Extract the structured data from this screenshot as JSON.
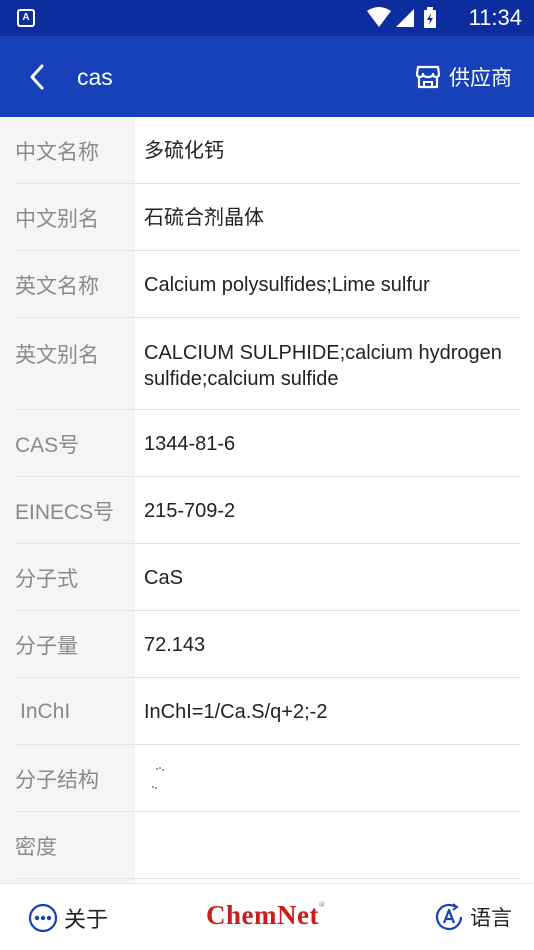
{
  "status_bar": {
    "notification_badge": "A",
    "time": "11:34",
    "icons": [
      "wifi-icon",
      "signal-icon",
      "battery-charging-icon"
    ]
  },
  "app_bar": {
    "title": "cas",
    "supplier_label": "供应商",
    "color": "#1641b9"
  },
  "details": [
    {
      "label": "中文名称",
      "value": "多硫化钙"
    },
    {
      "label": "中文别名",
      "value": "石硫合剂晶体"
    },
    {
      "label": "英文名称",
      "value": "Calcium polysulfides;Lime sulfur"
    },
    {
      "label": "英文别名",
      "value": "CALCIUM SULPHIDE;calcium hydrogen sulfide;calcium sulfide"
    },
    {
      "label": "CAS号",
      "value": "1344-81-6"
    },
    {
      "label": "EINECS号",
      "value": "215-709-2"
    },
    {
      "label": "分子式",
      "value": "CaS"
    },
    {
      "label": "分子量",
      "value": "72.143"
    },
    {
      "label": "InChI",
      "value": "InChI=1/Ca.S/q+2;-2"
    },
    {
      "label": "分子结构",
      "value": ""
    },
    {
      "label": "密度",
      "value": ""
    }
  ],
  "footer": {
    "about_label": "关于",
    "brand": "ChemNet",
    "brand_mark": "®",
    "language_label": "语言",
    "brand_color": "#c81e1e"
  }
}
